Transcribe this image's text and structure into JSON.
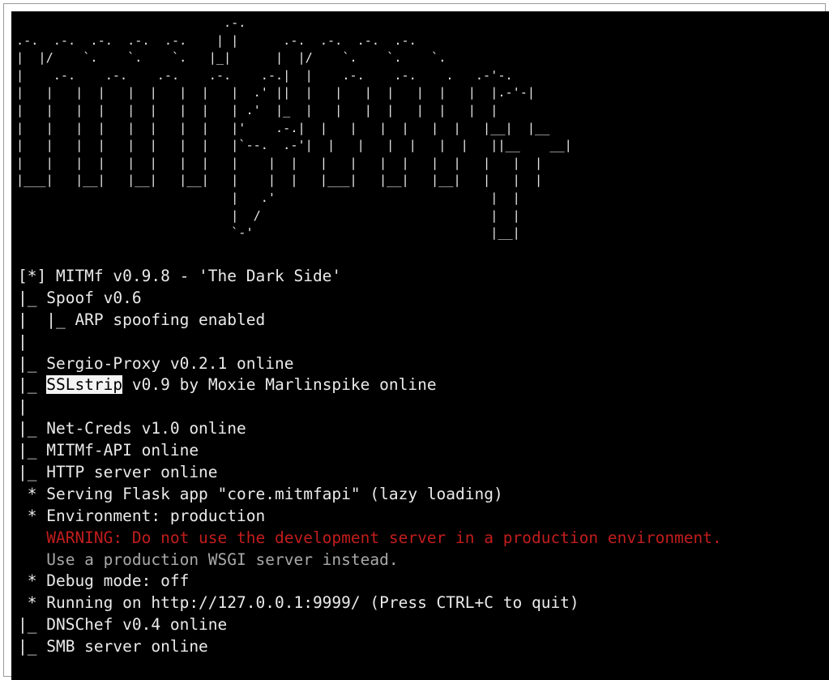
{
  "banner": {
    "ascii_art": "                            .-.\n.-.  .-.  .-.  .-.  .-.    | |      .-.  .-.  .-.  .-.\n|  |/    `.    `.    `.   |_|      |  |/    `.    `.    `.\n|    .-.    .-.    .-.    .-.    .-.|  |    .-.    .-.    .   .-'-.\n|   |   |  |   |  |   |  |   |  .' ||  |   |   |  |   |  |   |  |.-'-|\n|   |   |  |   |  |   |  |   | .'  |_  |   |   |  |   |  |   |  |\n|   |   |  |   |  |   |  |   |'    .-.|  |   |   |  |   |  |   |__|  |__\n|   |   |  |   |  |   |  |   |`--.  .-'|  |   |   |  |   |  |   ||__    __|\n|   |   |  |   |  |   |  |   |    |  |   |   |   |  |   |  |   |   |  |\n|___|   |__|   |__|   |__|   |    |  |   |___|   |__|   |__|   |   |  |\n                             |   .'                             |  |\n                             |  /                               |  |\n                             `-'                                |__|"
  },
  "log": {
    "header": "[*] MITMf v0.9.8 - 'The Dark Side'",
    "spoof": "|_ Spoof v0.6",
    "arp": "|  |_ ARP spoofing enabled",
    "pipe1": "|",
    "sergio": "|_ Sergio-Proxy v0.2.1 online",
    "ssl_prefix": "|_ ",
    "ssl_name": "SSLstrip",
    "ssl_suffix": " v0.9 by Moxie Marlinspike online",
    "pipe2": "|",
    "netcreds": "|_ Net-Creds v1.0 online",
    "api": "|_ MITMf-API online",
    "http": "|_ HTTP server online",
    "serving": " * Serving Flask app \"core.mitmfapi\" (lazy loading)",
    "environment": " * Environment: production",
    "warning": "   WARNING: Do not use the development server in a production environment.",
    "use_wsgi": "   Use a production WSGI server instead.",
    "debug": " * Debug mode: off",
    "running": " * Running on http://127.0.0.1:9999/ (Press CTRL+C to quit)",
    "dnschef": "|_ DNSChef v0.4 online",
    "smb": "|_ SMB server online"
  },
  "colors": {
    "background": "#000000",
    "text": "#eaeaea",
    "warning": "#c21d1d",
    "dim": "#a8a8a8",
    "selection": "#f4f4f4"
  }
}
